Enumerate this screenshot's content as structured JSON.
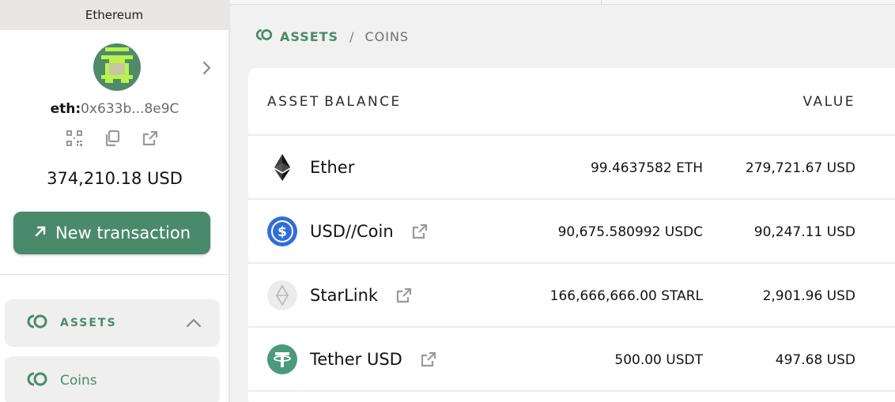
{
  "sidebar": {
    "network": "Ethereum",
    "address_prefix": "eth:",
    "address_short": "0x633b...8e9C",
    "balance": "374,210.18 USD",
    "new_tx_label": "New transaction",
    "new_tx_icon": "arrow-up-right-icon",
    "nav": [
      {
        "label": "ASSETS",
        "icon": "assets-icon",
        "expanded": true
      },
      {
        "label": "Coins",
        "icon": "assets-icon"
      }
    ],
    "colors": {
      "accent": "#4a8a6a",
      "avatar_green": "#b9f24a"
    }
  },
  "breadcrumb": {
    "parent": "ASSETS",
    "separator": "/",
    "current": "COINS"
  },
  "table": {
    "columns": [
      "ASSET",
      "BALANCE",
      "VALUE"
    ],
    "rows": [
      {
        "name": "Ether",
        "icon": "ethereum-icon",
        "balance": "99.4637582 ETH",
        "value": "279,721.67 USD",
        "external_link": false
      },
      {
        "name": "USD//Coin",
        "icon": "usdc-icon",
        "balance": "90,675.580992 USDC",
        "value": "90,247.11 USD",
        "external_link": true
      },
      {
        "name": "StarLink",
        "icon": "starlink-icon",
        "balance": "166,666,666.00 STARL",
        "value": "2,901.96 USD",
        "external_link": true
      },
      {
        "name": "Tether USD",
        "icon": "tether-icon",
        "balance": "500.00 USDT",
        "value": "497.68 USD",
        "external_link": true
      }
    ]
  }
}
